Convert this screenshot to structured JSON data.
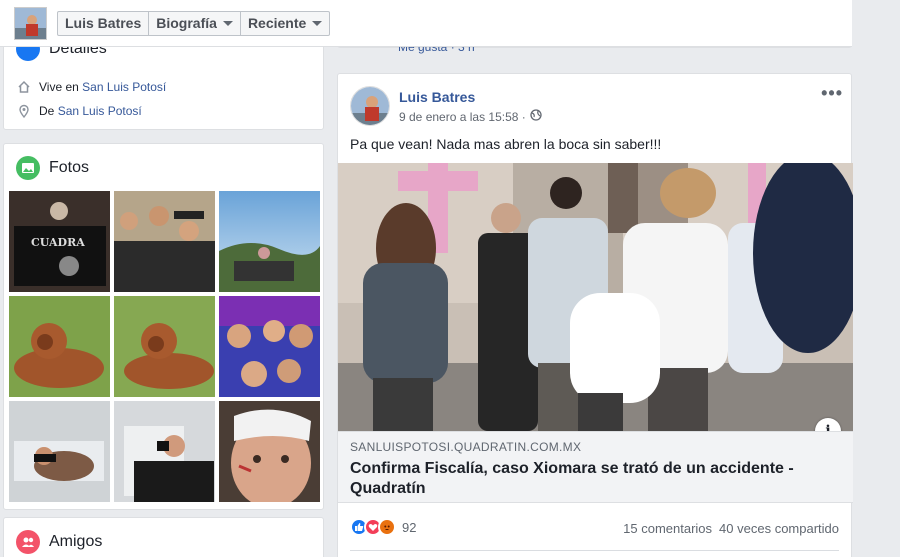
{
  "topbar": {
    "name": "Luis Batres",
    "tabs": [
      {
        "label": "Biografía"
      },
      {
        "label": "Reciente"
      }
    ]
  },
  "details": {
    "title": "Detalles",
    "lives_prefix": "Vive en",
    "lives_city": "San Luis Potosí",
    "from_prefix": "De",
    "from_city": "San Luis Potosí"
  },
  "fotos": {
    "title": "Fotos",
    "photos": [
      "photo-1",
      "photo-2",
      "photo-3",
      "photo-4",
      "photo-5",
      "photo-6",
      "photo-7",
      "photo-8",
      "photo-9"
    ]
  },
  "amigos": {
    "title": "Amigos"
  },
  "prev_post": {
    "partial_text": "Me gusta · 3 h"
  },
  "post": {
    "author": "Luis Batres",
    "time": "9 de enero a las 15:58 ·",
    "privacy_icon": "globe-icon",
    "text": "Pa que vean! Nada mas abren la boca sin saber!!!",
    "link": {
      "domain": "SANLUISPOTOSI.QUADRATIN.COM.MX",
      "title": "Confirma Fiscalía, caso Xiomara se trató de un accidente - Quadratín"
    },
    "reaction_count": "92",
    "comments": "15 comentarios",
    "shares": "40 veces compartido"
  },
  "colors": {
    "link": "#365899",
    "like": "#1877f2",
    "love": "#f33e58",
    "angry": "#e9710f"
  }
}
